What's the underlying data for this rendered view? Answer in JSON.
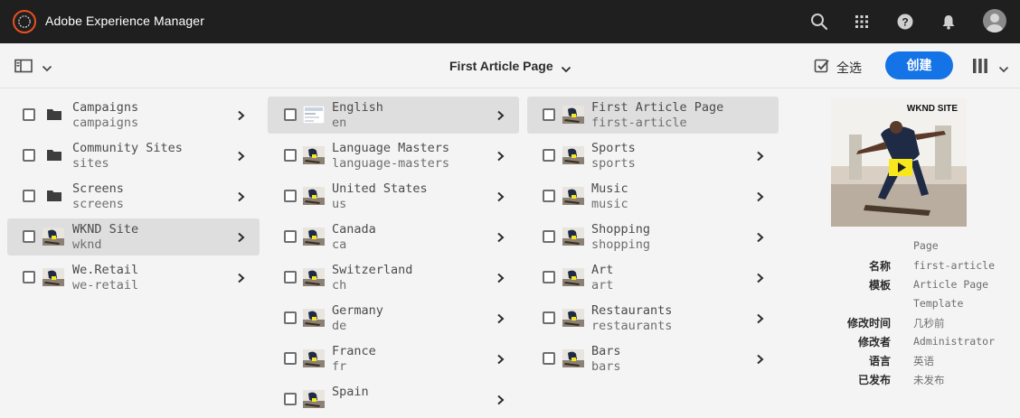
{
  "shell": {
    "app_title": "Adobe Experience Manager",
    "icons": [
      "search-icon",
      "apps-icon",
      "help-icon",
      "notifications-icon",
      "user-avatar"
    ]
  },
  "actionbar": {
    "breadcrumb": "First Article Page",
    "select_all": "全选",
    "create": "创建"
  },
  "columns": [
    [
      {
        "title": "Campaigns",
        "name": "campaigns",
        "kind": "folder",
        "selected": false
      },
      {
        "title": "Community Sites",
        "name": "sites",
        "kind": "folder",
        "selected": false
      },
      {
        "title": "Screens",
        "name": "screens",
        "kind": "folder",
        "selected": false
      },
      {
        "title": "WKND Site",
        "name": "wknd",
        "kind": "page",
        "selected": true
      },
      {
        "title": "We.Retail",
        "name": "we-retail",
        "kind": "page",
        "selected": false
      }
    ],
    [
      {
        "title": "English",
        "name": "en",
        "kind": "page",
        "selected": true
      },
      {
        "title": "Language Masters",
        "name": "language-masters",
        "kind": "page",
        "selected": false
      },
      {
        "title": "United States",
        "name": "us",
        "kind": "page",
        "selected": false
      },
      {
        "title": "Canada",
        "name": "ca",
        "kind": "page",
        "selected": false
      },
      {
        "title": "Switzerland",
        "name": "ch",
        "kind": "page",
        "selected": false
      },
      {
        "title": "Germany",
        "name": "de",
        "kind": "page",
        "selected": false
      },
      {
        "title": "France",
        "name": "fr",
        "kind": "page",
        "selected": false
      },
      {
        "title": "Spain",
        "name": "",
        "kind": "page",
        "selected": false
      }
    ],
    [
      {
        "title": "First Article Page",
        "name": "first-article",
        "kind": "page",
        "selected": true,
        "no_chevron": true
      },
      {
        "title": "Sports",
        "name": "sports",
        "kind": "page",
        "selected": false
      },
      {
        "title": "Music",
        "name": "music",
        "kind": "page",
        "selected": false
      },
      {
        "title": "Shopping",
        "name": "shopping",
        "kind": "page",
        "selected": false
      },
      {
        "title": "Art",
        "name": "art",
        "kind": "page",
        "selected": false
      },
      {
        "title": "Restaurants",
        "name": "restaurants",
        "kind": "page",
        "selected": false
      },
      {
        "title": "Bars",
        "name": "bars",
        "kind": "page",
        "selected": false
      }
    ]
  ],
  "preview": {
    "brand": "WKND SITE",
    "type": "Page",
    "meta": [
      {
        "key": "名称",
        "value": "first-article"
      },
      {
        "key": "模板",
        "value": "Article Page"
      },
      {
        "key": "",
        "value": "Template"
      },
      {
        "key": "修改时间",
        "value": "几秒前"
      },
      {
        "key": "修改者",
        "value": "Administrator"
      },
      {
        "key": "语言",
        "value": "英语"
      },
      {
        "key": "已发布",
        "value": "未发布"
      }
    ]
  },
  "colors": {
    "accent": "#1473e6",
    "shell": "#1f1f1f",
    "logo": "#e8501e",
    "selected_row": "#dedede"
  }
}
